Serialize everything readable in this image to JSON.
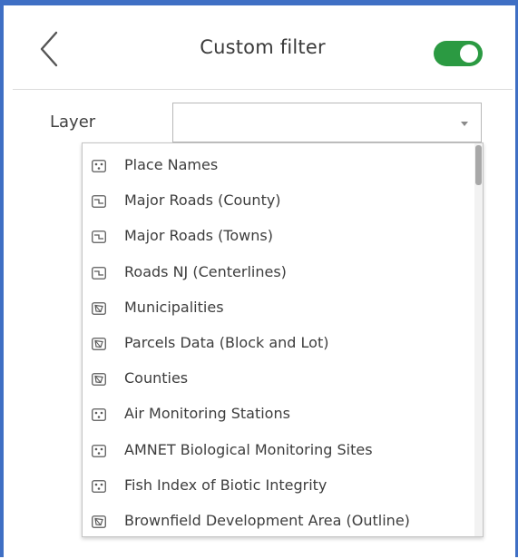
{
  "header": {
    "title": "Custom filter",
    "toggle_on": true
  },
  "filter": {
    "layer_label": "Layer",
    "layer_value": ""
  },
  "dropdown": {
    "items": [
      {
        "label": "Place Names",
        "icon": "point-layer-icon"
      },
      {
        "label": "Major Roads (County)",
        "icon": "line-layer-icon"
      },
      {
        "label": "Major Roads (Towns)",
        "icon": "line-layer-icon"
      },
      {
        "label": "Roads NJ (Centerlines)",
        "icon": "line-layer-icon"
      },
      {
        "label": "Municipalities",
        "icon": "polygon-layer-icon"
      },
      {
        "label": "Parcels Data (Block and Lot)",
        "icon": "polygon-layer-icon"
      },
      {
        "label": "Counties",
        "icon": "polygon-layer-icon"
      },
      {
        "label": "Air Monitoring Stations",
        "icon": "point-layer-icon"
      },
      {
        "label": "AMNET Biological Monitoring Sites",
        "icon": "point-layer-icon"
      },
      {
        "label": "Fish Index of Biotic Integrity",
        "icon": "point-layer-icon"
      },
      {
        "label": "Brownfield Development Area (Outline)",
        "icon": "polygon-layer-icon"
      }
    ]
  },
  "colors": {
    "accent_border": "#3f6fc4",
    "toggle_on": "#2b9a42"
  }
}
